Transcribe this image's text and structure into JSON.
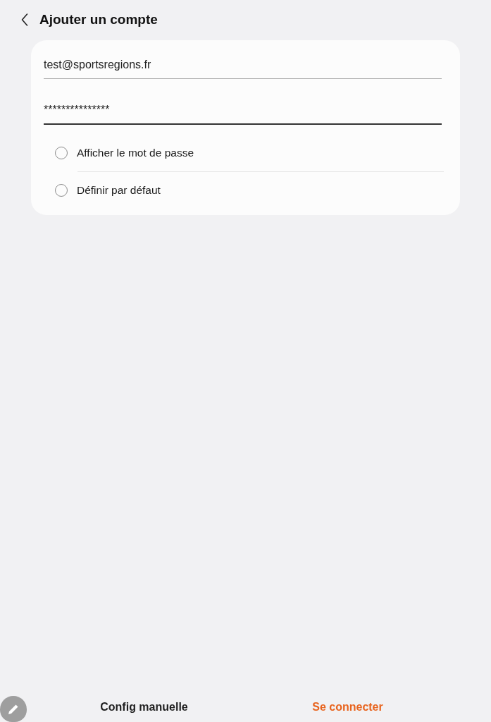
{
  "header": {
    "title": "Ajouter un compte"
  },
  "form": {
    "fields": [
      {
        "value": "test@sportsregions.fr",
        "focused": false
      },
      {
        "value": "***************",
        "focused": true
      }
    ],
    "options": [
      {
        "label": "Afficher le mot de passe",
        "checked": false
      },
      {
        "label": "Définir par défaut",
        "checked": false
      }
    ]
  },
  "actions": [
    {
      "label": "Config manuelle",
      "kind": "secondary"
    },
    {
      "label": "Se connecter",
      "kind": "primary"
    }
  ]
}
